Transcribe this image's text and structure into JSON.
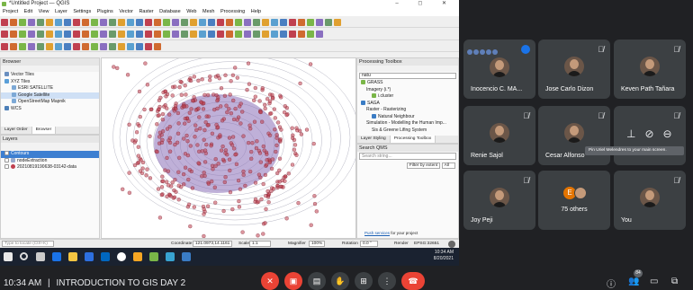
{
  "qgis": {
    "title": "*Untitled Project — QGIS",
    "window_controls": "– ◻ ✕",
    "menu": [
      "Project",
      "Edit",
      "View",
      "Layer",
      "Settings",
      "Plugins",
      "Vector",
      "Raster",
      "Database",
      "Web",
      "Mesh",
      "Processing",
      "Help"
    ],
    "browser": {
      "title": "Browser",
      "items": [
        "Vector Tiles",
        "XYZ Tiles",
        "ESRI SATELLITE",
        "Google Satellite",
        "OpenStreetMap Mapnik",
        "WCS"
      ],
      "tabs": [
        "Layer Order",
        "Browser"
      ]
    },
    "layers": {
      "title": "Layers",
      "items": [
        "Contours",
        "nodeExtraction",
        "20210819190638-03142-data"
      ]
    },
    "toolbox": {
      "title": "Processing Toolbox",
      "search_value": "natu",
      "items": [
        "GRASS",
        "Imagery (i.*)",
        "i.cluster",
        "SAGA",
        "Raster - Rasterizing",
        "Natural Neighbour",
        "Simulation - Modelling the Human Imp...",
        "Sis & Greene Lifing System"
      ],
      "tabs": [
        "Layer Styling",
        "Processing Toolbox"
      ],
      "search_qms_title": "Search QMS",
      "search_qms_placeholder": "Search string...",
      "filter_label": "Filter by extent",
      "filter_value": "All",
      "footer_link": "Push services",
      "footer_text": "for your project"
    },
    "status": {
      "locate_placeholder": "Type to locate (Ctrl+K)",
      "coordinate_label": "Coordinate",
      "coordinate_value": "121.0973,14.1161",
      "scale_label": "Scale",
      "scale_value": "1:1",
      "magnifier_label": "Magnifier",
      "magnifier_value": "100%",
      "rotation_label": "Rotation",
      "rotation_value": "0.0 °",
      "render_label": "Render",
      "crs_value": "EPSG:32651"
    },
    "taskbar": {
      "time": "10:34 AM",
      "date": "8/20/2021"
    }
  },
  "meet": {
    "tiles": [
      {
        "name": "Inocencio C. MA...",
        "muted": false,
        "presenting": true
      },
      {
        "name": "Jose Carlo Dizon",
        "muted": true
      },
      {
        "name": "Keven Path Tañara",
        "muted": true
      },
      {
        "name": "Renie Sajol",
        "muted": true
      },
      {
        "name": "Cesar Alfonso",
        "muted": true
      },
      {
        "name": "",
        "muted": true
      },
      {
        "name": "Joy Peji",
        "muted": true
      },
      {
        "name": "75 others",
        "initial": "E"
      },
      {
        "name": "You",
        "muted": true
      }
    ],
    "pin_tooltip": "Pin Uriel Melendres to your main screen.",
    "meeting_time": "10:34 AM",
    "meeting_separator": "|",
    "meeting_title": "INTRODUCTION TO GIS DAY 2",
    "participant_count": "84"
  },
  "colors": {
    "meet_bg": "#202124",
    "tile_bg": "#3c4043",
    "end_call": "#ea4335",
    "map_points": "#c0404f"
  }
}
